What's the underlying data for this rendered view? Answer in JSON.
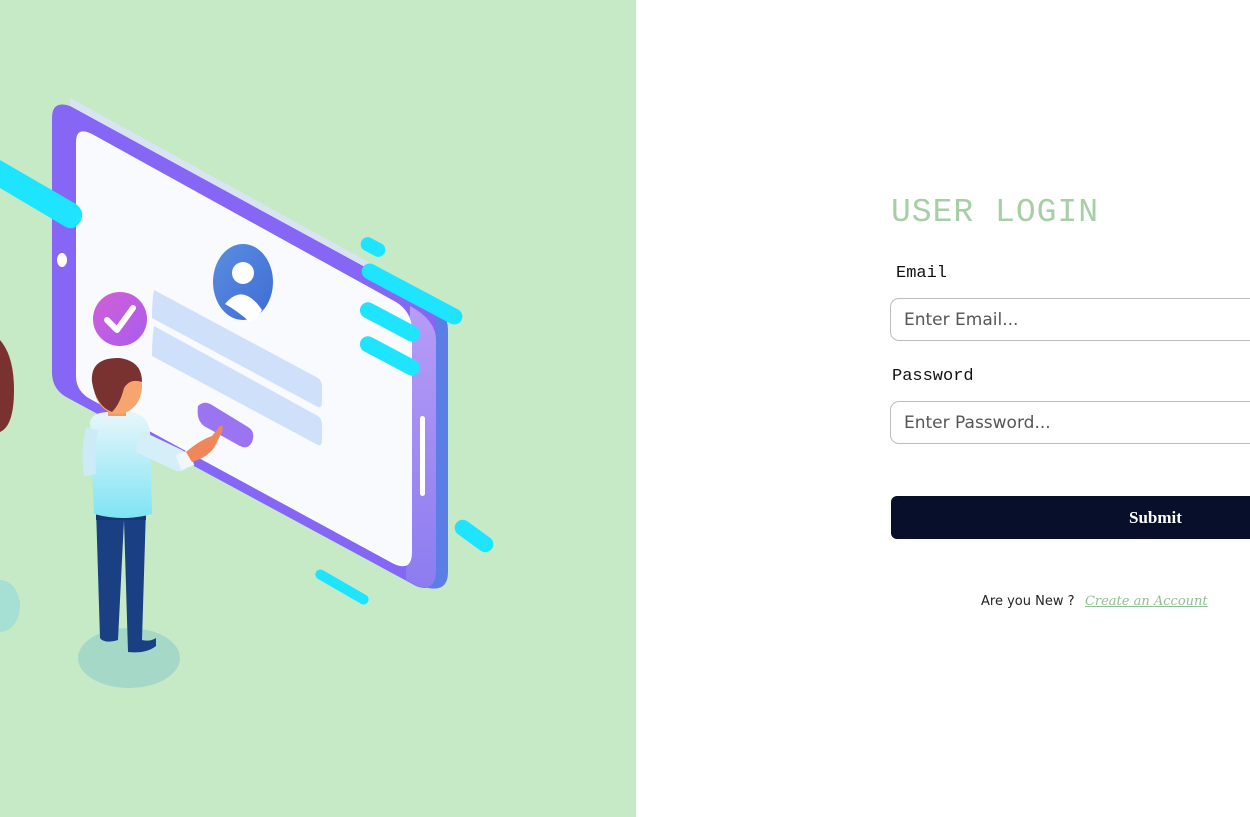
{
  "login": {
    "title": "USER LOGIN",
    "email_label": "Email",
    "email_placeholder": "Enter Email...",
    "email_value": "",
    "password_label": "Password",
    "password_placeholder": "Enter Password...",
    "password_value": "",
    "submit_label": "Submit",
    "signup_question": "Are you New ?",
    "signup_link": "Create an Account"
  },
  "colors": {
    "left_background": "#c6eac6",
    "title_green": "#a6cfa6",
    "submit_background": "#080f2b",
    "link_green": "#8fc08f"
  },
  "illustration": {
    "description_icons": [
      "user-avatar-icon",
      "check-badge-icon"
    ]
  }
}
